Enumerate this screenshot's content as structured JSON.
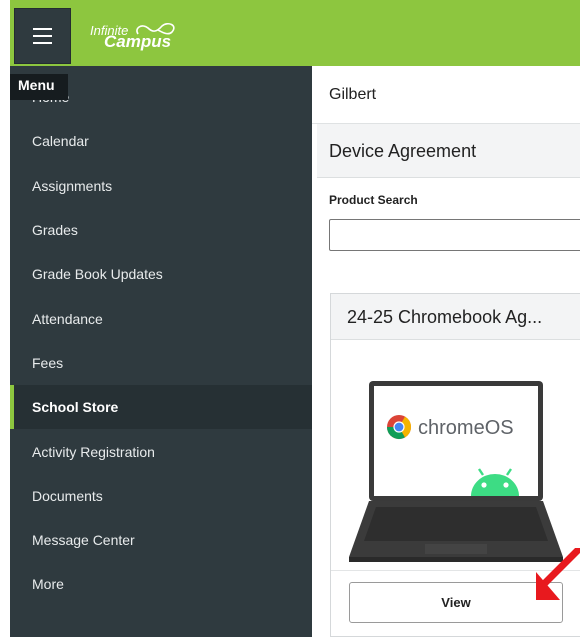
{
  "header": {
    "menu_tooltip": "Menu",
    "logo_line1": "Infinite",
    "logo_line2": "Campus"
  },
  "sidebar": {
    "items": [
      {
        "label": "Home"
      },
      {
        "label": "Calendar"
      },
      {
        "label": "Assignments"
      },
      {
        "label": "Grades"
      },
      {
        "label": "Grade Book Updates"
      },
      {
        "label": "Attendance"
      },
      {
        "label": "Fees"
      },
      {
        "label": "School Store",
        "active": true
      },
      {
        "label": "Activity Registration"
      },
      {
        "label": "Documents"
      },
      {
        "label": "Message Center"
      },
      {
        "label": "More"
      }
    ]
  },
  "main": {
    "student_name": "Gilbert",
    "section_title": "Device Agreement",
    "search_label": "Product Search",
    "search_value": "",
    "product": {
      "title": "24-25 Chromebook Ag...",
      "image_text": "chromeOS",
      "view_label": "View"
    }
  },
  "colors": {
    "brand_green": "#8dc63f",
    "sidebar_bg": "#2f3a3f",
    "annotation_arrow": "#e8191e"
  }
}
